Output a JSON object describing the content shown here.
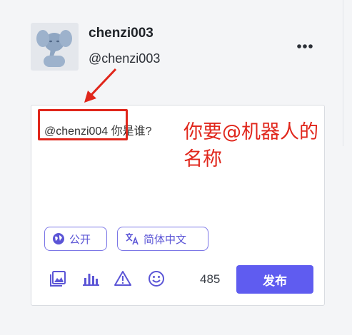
{
  "profile": {
    "display_name": "chenzi003",
    "handle": "@chenzi003"
  },
  "compose": {
    "mention": "@chenzi004",
    "message": " 你是谁?",
    "visibility_label": "公开",
    "language_label": "简体中文",
    "char_count": "485",
    "publish_label": "发布"
  },
  "annotation": {
    "line1": "你要@机器人的",
    "line2": "名称",
    "color": "#e0261b"
  },
  "colors": {
    "accent": "#5f5cf0",
    "chip_border": "#7b76e6"
  },
  "icons": [
    "mastodon-avatar-icon",
    "more-options-icon",
    "globe-icon",
    "translate-icon",
    "image-icon",
    "poll-icon",
    "warning-icon",
    "emoji-icon"
  ]
}
